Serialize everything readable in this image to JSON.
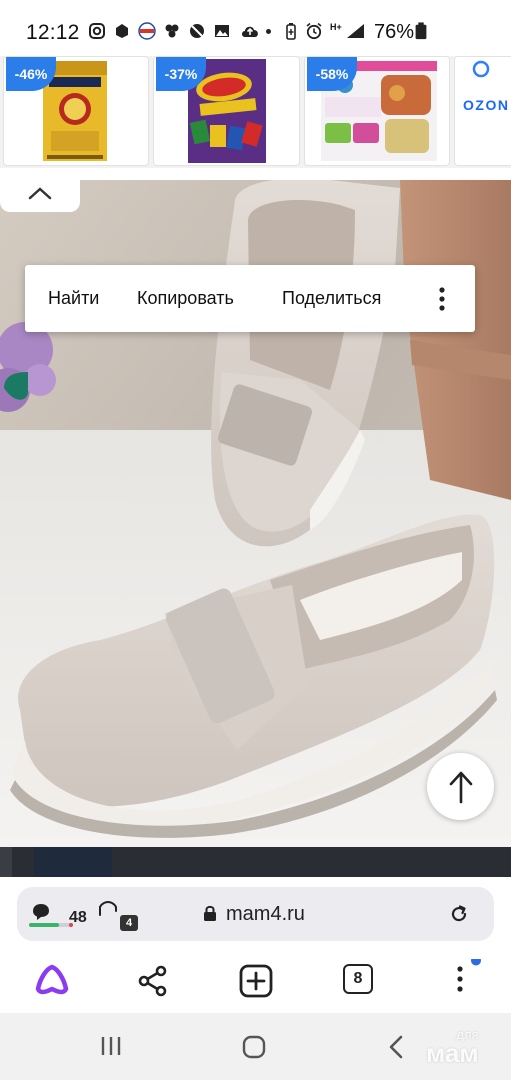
{
  "status_bar": {
    "time": "12:12",
    "battery": "76%",
    "network": "H+"
  },
  "ads": [
    {
      "discount": "-46%",
      "product": "Lavazza Oro coffee"
    },
    {
      "discount": "-37%",
      "product": "UNO Flip! cards"
    },
    {
      "discount": "-58%",
      "product": "Weight-loss meal kit"
    },
    {
      "brand": "OZON"
    }
  ],
  "context_menu": {
    "find": "Найти",
    "copy": "Копировать",
    "share": "Поделиться"
  },
  "address_bar": {
    "comments": "48",
    "protect_count": "4",
    "url": "mam4.ru"
  },
  "toolbar": {
    "tabs_count": "8"
  },
  "watermark": {
    "top": "для",
    "bottom": "мам"
  },
  "colors": {
    "accent_purple": "#8b3cf0",
    "badge_blue": "#2b7de9",
    "notification_dot": "#2f6ae8"
  }
}
